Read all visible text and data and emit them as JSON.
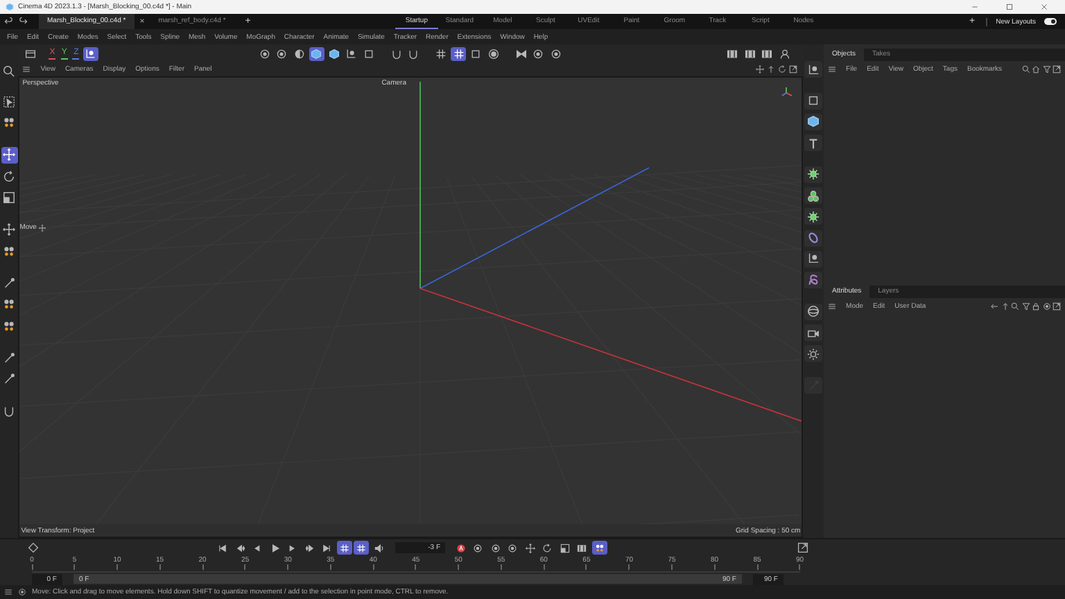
{
  "window": {
    "title": "Cinema 4D 2023.1.3 - [Marsh_Blocking_00.c4d *] - Main"
  },
  "document_tabs": [
    {
      "label": "Marsh_Blocking_00.c4d *",
      "selected": true
    },
    {
      "label": "marsh_ref_body.c4d *",
      "selected": false
    }
  ],
  "close_tab_button": "×",
  "new_document_button": "+",
  "layout_tabs": [
    {
      "label": "Startup",
      "selected": true
    },
    {
      "label": "Standard",
      "selected": false
    },
    {
      "label": "Model",
      "selected": false
    },
    {
      "label": "Sculpt",
      "selected": false
    },
    {
      "label": "UVEdit",
      "selected": false
    },
    {
      "label": "Paint",
      "selected": false
    },
    {
      "label": "Groom",
      "selected": false
    },
    {
      "label": "Track",
      "selected": false
    },
    {
      "label": "Script",
      "selected": false
    },
    {
      "label": "Nodes",
      "selected": false
    }
  ],
  "add_layout_button": "+",
  "new_layouts": {
    "label": "New Layouts",
    "on": true
  },
  "menu": [
    "File",
    "Edit",
    "Create",
    "Modes",
    "Select",
    "Tools",
    "Spline",
    "Mesh",
    "Volume",
    "MoGraph",
    "Character",
    "Animate",
    "Simulate",
    "Tracker",
    "Render",
    "Extensions",
    "Window",
    "Help"
  ],
  "axis_locks": [
    {
      "label": "X",
      "color": "#e0505a"
    },
    {
      "label": "Y",
      "color": "#5ad05a"
    },
    {
      "label": "Z",
      "color": "#5a7ae0"
    }
  ],
  "toolbar_groups": [
    [
      {
        "kind": "circle-dot",
        "selected": false
      },
      {
        "kind": "circle-dot",
        "selected": false
      },
      {
        "kind": "half-circle",
        "selected": false
      },
      {
        "kind": "cube",
        "selected": true
      },
      {
        "kind": "cube",
        "selected": false
      },
      {
        "kind": "axes",
        "selected": false
      },
      {
        "kind": "square",
        "selected": false
      }
    ],
    [
      {
        "kind": "magnet",
        "selected": false
      },
      {
        "kind": "magnet",
        "selected": false
      }
    ],
    [
      {
        "kind": "grid",
        "selected": false
      },
      {
        "kind": "grid",
        "selected": true
      },
      {
        "kind": "square",
        "selected": false
      },
      {
        "kind": "target",
        "selected": false
      }
    ],
    [
      {
        "kind": "bow",
        "selected": false
      },
      {
        "kind": "circle-dot",
        "selected": false
      },
      {
        "kind": "circle-dot",
        "selected": false
      }
    ],
    [
      {
        "kind": "film",
        "selected": false
      },
      {
        "kind": "film",
        "selected": false
      },
      {
        "kind": "film",
        "selected": false
      },
      {
        "kind": "person",
        "selected": false
      }
    ]
  ],
  "tools": [
    {
      "kind": "select",
      "selected": false
    },
    {
      "kind": "points",
      "selected": false
    },
    {
      "kind": "move",
      "selected": true
    },
    {
      "kind": "rotate",
      "selected": false
    },
    {
      "kind": "scale",
      "selected": false
    },
    {
      "kind": "move",
      "selected": false
    },
    {
      "kind": "points",
      "selected": false
    },
    {
      "kind": "pen",
      "selected": false
    },
    {
      "kind": "points",
      "selected": false
    },
    {
      "kind": "points",
      "selected": false
    },
    {
      "kind": "pen",
      "selected": false
    },
    {
      "kind": "pen",
      "selected": false
    },
    {
      "kind": "magnet",
      "selected": false
    }
  ],
  "viewport": {
    "menu": [
      "View",
      "Cameras",
      "Display",
      "Options",
      "Filter",
      "Panel"
    ],
    "name": "Perspective",
    "camera": "Camera",
    "tooltip": "Move",
    "view_transform": "View Transform: Project",
    "grid_spacing": "Grid Spacing : 50 cm"
  },
  "palette": [
    {
      "kind": "axes",
      "disabled": false
    },
    {
      "kind": "square",
      "disabled": false
    },
    {
      "kind": "cube",
      "disabled": false
    },
    {
      "kind": "text",
      "disabled": false
    },
    {
      "kind": "gear",
      "disabled": false
    },
    {
      "kind": "clones",
      "disabled": false
    },
    {
      "kind": "gear",
      "disabled": false
    },
    {
      "kind": "ring",
      "disabled": false
    },
    {
      "kind": "axes",
      "disabled": false
    },
    {
      "kind": "knot",
      "disabled": false
    },
    {
      "kind": "sphere",
      "disabled": false
    },
    {
      "kind": "camera",
      "disabled": false
    },
    {
      "kind": "light",
      "disabled": false
    },
    {
      "kind": "pen",
      "disabled": true
    }
  ],
  "objects_panel": {
    "tabs": [
      {
        "label": "Objects",
        "selected": true
      },
      {
        "label": "Takes",
        "selected": false
      }
    ],
    "menu": [
      "File",
      "Edit",
      "View",
      "Object",
      "Tags",
      "Bookmarks"
    ]
  },
  "attributes_panel": {
    "tabs": [
      {
        "label": "Attributes",
        "selected": true
      },
      {
        "label": "Layers",
        "selected": false
      }
    ],
    "menu": [
      "Mode",
      "Edit",
      "User Data"
    ]
  },
  "timeline": {
    "transport": [
      {
        "kind": "skip-start",
        "selected": false
      },
      {
        "kind": "prev-key",
        "selected": false
      },
      {
        "kind": "step-back",
        "selected": false
      },
      {
        "kind": "play",
        "selected": false
      },
      {
        "kind": "step-fwd",
        "selected": false
      },
      {
        "kind": "next-key",
        "selected": false
      },
      {
        "kind": "skip-end",
        "selected": false
      },
      {
        "kind": "grid",
        "selected": true
      },
      {
        "kind": "grid",
        "selected": true
      },
      {
        "kind": "speaker",
        "selected": false
      }
    ],
    "current_frame": "-3 F",
    "keys": [
      {
        "kind": "record",
        "selected": false
      },
      {
        "kind": "circle-dot",
        "selected": false
      },
      {
        "kind": "circle-dot",
        "selected": false
      },
      {
        "kind": "circle-dot",
        "selected": false
      },
      {
        "kind": "move",
        "selected": false
      },
      {
        "kind": "rotate",
        "selected": false
      },
      {
        "kind": "scale",
        "selected": false
      },
      {
        "kind": "film",
        "selected": false
      },
      {
        "kind": "points",
        "selected": true
      }
    ],
    "ruler": [
      "0",
      "5",
      "10",
      "15",
      "20",
      "25",
      "30",
      "35",
      "40",
      "45",
      "50",
      "55",
      "60",
      "65",
      "70",
      "75",
      "80",
      "85",
      "90"
    ],
    "start_field": "0 F",
    "range": {
      "level": 1,
      "start": "0 F",
      "end": "90 F"
    },
    "end_field": "90 F"
  },
  "status": "Move: Click and drag to move elements. Hold down SHIFT to quantize movement / add to the selection in point mode, CTRL to remove."
}
